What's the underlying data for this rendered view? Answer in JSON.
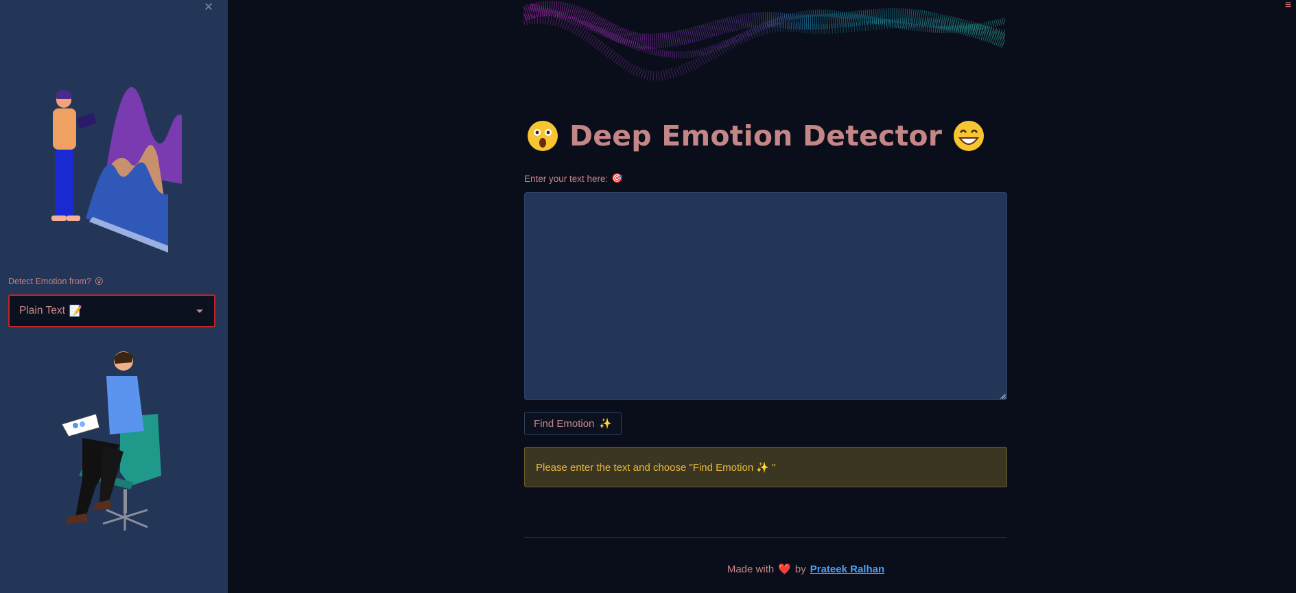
{
  "sidebar": {
    "close_glyph": "×",
    "select_label": "Detect Emotion from?",
    "select_label_emoji": "😮",
    "select_value": "Plain Text",
    "select_value_emoji": "📝"
  },
  "main": {
    "title": "Deep Emotion Detector",
    "title_left_emoji": "astonished-face",
    "title_right_emoji": "grinning-face",
    "textarea_label": "Enter your text here:",
    "textarea_label_emoji": "🎯",
    "textarea_value": "",
    "find_button_label": "Find Emotion",
    "find_button_emoji": "✨",
    "alert_text": "Please enter the text and choose \"Find Emotion ✨ \""
  },
  "footer": {
    "made_with": "Made with",
    "heart": "❤️",
    "by": "by",
    "author": "Prateek Ralhan"
  },
  "colors": {
    "background": "#0a0e1a",
    "sidebar": "#243658",
    "accent_text": "#c48686",
    "select_border": "#c0251f",
    "alert_bg": "#3b3622",
    "alert_text": "#e8b83a",
    "link": "#4a9ff5"
  }
}
